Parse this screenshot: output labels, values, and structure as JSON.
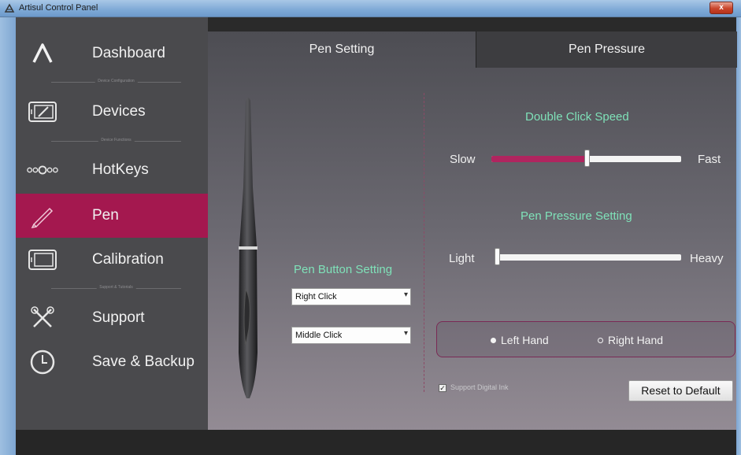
{
  "window": {
    "title": "Artisul Control Panel",
    "close_label": "x"
  },
  "sidebar": {
    "items": [
      {
        "label": "Dashboard",
        "icon": "artisul-logo-icon"
      },
      {
        "label": "Devices",
        "icon": "tablet-icon"
      },
      {
        "label": "HotKeys",
        "icon": "hotkeys-icon"
      },
      {
        "label": "Pen",
        "icon": "pen-icon"
      },
      {
        "label": "Calibration",
        "icon": "calibration-icon"
      },
      {
        "label": "Support",
        "icon": "tools-icon"
      },
      {
        "label": "Save & Backup",
        "icon": "clock-icon"
      }
    ],
    "separators": [
      "Device Configuration",
      "Device Functions",
      "Support & Tutorials"
    ]
  },
  "tabs": [
    {
      "label": "Pen Setting",
      "active": true
    },
    {
      "label": "Pen Pressure",
      "active": false
    }
  ],
  "pen_button": {
    "title": "Pen Button Setting",
    "upper_select": "Right Click",
    "lower_select": "Middle Click"
  },
  "double_click": {
    "title": "Double Click Speed",
    "min_label": "Slow",
    "max_label": "Fast",
    "value": 0.5
  },
  "pressure": {
    "title": "Pen Pressure Setting",
    "min_label": "Light",
    "max_label": "Heavy",
    "value": 0.0
  },
  "hand": {
    "left_label": "Left Hand",
    "right_label": "Right Hand",
    "selected": "left"
  },
  "digital_ink": {
    "label": "Support Digital Ink",
    "checked": true
  },
  "reset_label": "Reset to Default",
  "colors": {
    "accent": "#a4184f",
    "heading": "#7fe2b9",
    "sidebar": "#4a4a4d"
  }
}
